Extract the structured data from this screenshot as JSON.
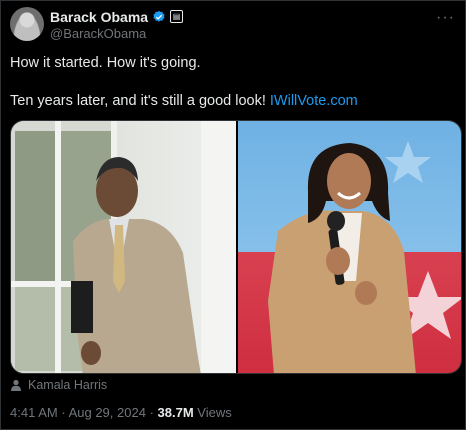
{
  "author": {
    "name": "Barack Obama",
    "handle": "@BarackObama",
    "avatar_icon": "avatar-photo",
    "verified_icon": "verified-badge-icon",
    "affiliation_icon": "government-badge-icon"
  },
  "tweet": {
    "line1": "How it started. How it's going.",
    "line2": "Ten years later, and it's still a good look!",
    "link": "IWillVote.com"
  },
  "media": {
    "tag_icon": "person-icon",
    "tagged_person": "Kamala Harris"
  },
  "meta": {
    "time": "4:41 AM",
    "sep1": "·",
    "date": "Aug 29, 2024",
    "sep2": "·",
    "views_count": "38.7M",
    "views_label": "Views"
  },
  "colors": {
    "background": "#000000",
    "text": "#e7e9ea",
    "secondary": "#71767b",
    "link": "#1d9bf0",
    "verified": "#1d9bf0"
  }
}
